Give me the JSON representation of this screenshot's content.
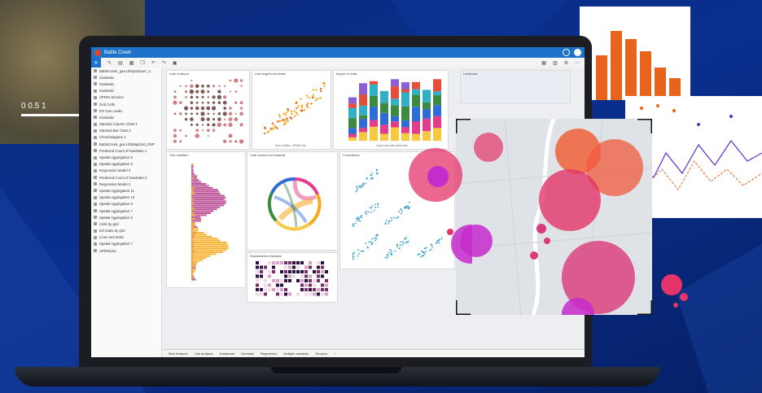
{
  "satellite": {
    "scale_labels": "0   0.5   1"
  },
  "app": {
    "title": "Battle Creek",
    "toolbar": {
      "plus": "+"
    },
    "sidebar": [
      "BattleCreek_gas Lifts(andover_2...",
      "Gasleaks",
      "Gasleaks",
      "Gasleaks",
      "UPDM Junction",
      "Grid Cells",
      "EO Gas Leaks",
      "Gasleaks",
      "Stacked Column Chart 1",
      "Stacked Bar Chart 2",
      "Chord Diagram 1",
      "BattleCreek_gas Lift(MapGrid_DSP",
      "Predicted Count of Gasleaks 1",
      "Spatial Aggregation 6",
      "Spatial Aggregation 5",
      "Regression Model 3",
      "Predicted Count of Gasleaks 3",
      "Regression Model 2",
      "Spatial Aggregation 11",
      "Spatial Aggregation 10",
      "Spatial Aggregation 9",
      "Spatial Aggregation 7",
      "Spatial Aggregation 8",
      "Cells by grid",
      "EO leaks by grid",
      "Lines and leaks",
      "Spatial Aggregation 7",
      "UPDMLine"
    ],
    "cards": {
      "leak_locations": "Leak locations",
      "line_lengths": "Line lengths and leaks",
      "impact": "Impact of leaks",
      "landcover": "Landcover",
      "year_installed": "Year installed",
      "causes": "Leak causes and material",
      "correlations": "Correlations",
      "residuals": "Standardized residuals",
      "cause_work": "Cause and work performed",
      "sum_miles": "Sum of Miles - UPDM Line",
      "count_gasleaks": "Count of Gasleaks",
      "count_gridcells": "Count of GridCells"
    },
    "footer_tabs": [
      "New features",
      "Link analysis",
      "Dataframe",
      "Domains",
      "Regression",
      "Multiple variables",
      "Geoproc",
      "+"
    ]
  },
  "colors": {
    "accent": "#1d73c9",
    "bg": "#0a2f8f"
  }
}
